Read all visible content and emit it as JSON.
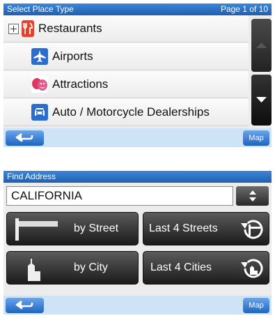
{
  "place_type": {
    "title": "Select Place Type",
    "page": "Page 1 of 10",
    "items": [
      {
        "label": "Restaurants",
        "icon": "fork-knife-icon",
        "color": "#e8402a"
      },
      {
        "label": "Airports",
        "icon": "airplane-icon",
        "color": "#2a6dcc"
      },
      {
        "label": "Attractions",
        "icon": "theater-masks-icon",
        "color": "#d83a5c"
      },
      {
        "label": "Auto / Motorcycle Dealerships",
        "icon": "car-icon",
        "color": "#2a6dcc"
      }
    ],
    "map_label": "Map"
  },
  "find_address": {
    "title": "Find Address",
    "state_value": "CALIFORNIA",
    "by_street_label": "by Street",
    "last_streets_label": "Last 4 Streets",
    "by_city_label": "by City",
    "last_cities_label": "Last 4 Cities",
    "map_label": "Map"
  }
}
